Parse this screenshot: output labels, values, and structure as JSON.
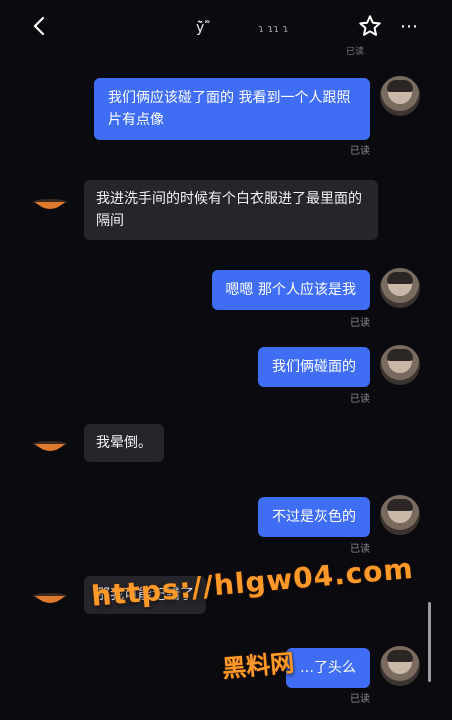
{
  "header": {
    "title": "ÿ̀́̂ ̃̄̅",
    "title_sub": "ɿ ɿɿ ɿ",
    "read_top": "已读"
  },
  "messages": [
    {
      "dir": "out",
      "text": "我们俩应该碰了面的  我看到一个人跟照片有点像",
      "read": "已读"
    },
    {
      "dir": "in",
      "text": "我进洗手间的时候有个白衣服进了最里面的隔间"
    },
    {
      "dir": "out",
      "text": "嗯嗯  那个人应该是我",
      "read": "已读"
    },
    {
      "dir": "out",
      "text": "我们俩碰面的",
      "read": "已读"
    },
    {
      "dir": "in",
      "text": "我晕倒。"
    },
    {
      "dir": "out",
      "text": "不过是灰色的",
      "read": "已读"
    },
    {
      "dir": "in",
      "text": "那我可能记错了"
    },
    {
      "dir": "out",
      "text": "…了头么",
      "read": "已读"
    }
  ],
  "watermark": {
    "url": "https://hlgw04.com",
    "name": "黑料网"
  },
  "colors": {
    "bubble_out": "#3f6ef4",
    "bubble_in": "#25252b",
    "watermark": "#ff9a2a"
  },
  "icons": [
    "back-arrow-icon",
    "star-icon",
    "more-icon"
  ]
}
